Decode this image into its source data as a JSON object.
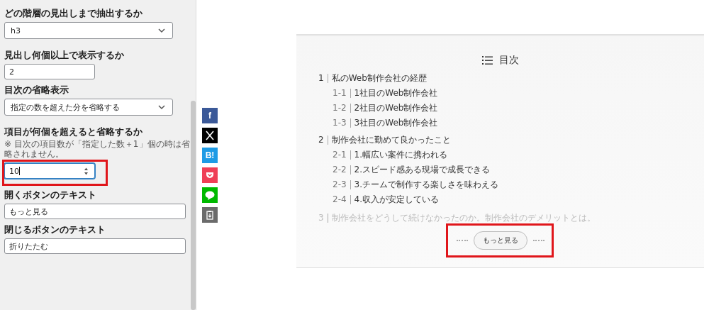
{
  "settings": {
    "fields": [
      {
        "label": "どの階層の見出しまで抽出するか",
        "kind": "select",
        "value": "h3"
      },
      {
        "label": "見出し何個以上で表示するか",
        "kind": "text",
        "value": "2",
        "wide": false
      },
      {
        "label": "目次の省略表示",
        "kind": "select",
        "value": "指定の数を超えた分を省略する"
      },
      {
        "label": "項目が何個を超えると省略するか",
        "note": "※ 目次の項目数が「指定した数＋1」個の時は省略されません。",
        "kind": "number",
        "value": "10",
        "focused": true,
        "highlighted": true
      },
      {
        "label": "開くボタンのテキスト",
        "kind": "text",
        "value": "もっと見る",
        "wide": true
      },
      {
        "label": "閉じるボタンのテキスト",
        "kind": "text",
        "value": "折りたたむ",
        "wide": true
      }
    ]
  },
  "share_buttons": [
    {
      "kind": "facebook",
      "label": "f",
      "color": "#3b5998"
    },
    {
      "kind": "x",
      "color": "#000000"
    },
    {
      "kind": "hatena",
      "label": "B!",
      "color": "#1e9be5"
    },
    {
      "kind": "pocket",
      "color": "#ef3f56"
    },
    {
      "kind": "line",
      "color": "#00b900"
    },
    {
      "kind": "copy",
      "color": "#6b6b6b"
    }
  ],
  "toc": {
    "title": "目次",
    "items": [
      {
        "number": "1",
        "text": "私のWeb制作会社の経歴",
        "children": [
          {
            "number": "1-1",
            "text": "1社目のWeb制作会社"
          },
          {
            "number": "1-2",
            "text": "2社目のWeb制作会社"
          },
          {
            "number": "1-3",
            "text": "3社目のWeb制作会社"
          }
        ]
      },
      {
        "number": "2",
        "text": "制作会社に勤めて良かったこと",
        "children": [
          {
            "number": "2-1",
            "text": "1.幅広い案件に携われる"
          },
          {
            "number": "2-2",
            "text": "2.スピード感ある現場で成長できる"
          },
          {
            "number": "2-3",
            "text": "3.チームで制作する楽しさを味わえる"
          },
          {
            "number": "2-4",
            "text": "4.収入が安定している"
          }
        ]
      },
      {
        "number": "3",
        "text": "制作会社をどうして続けなかったのか。制作会社のデメリットとは。",
        "faded": true
      }
    ],
    "more_button": {
      "label": "もっと見る",
      "highlighted": true
    }
  }
}
